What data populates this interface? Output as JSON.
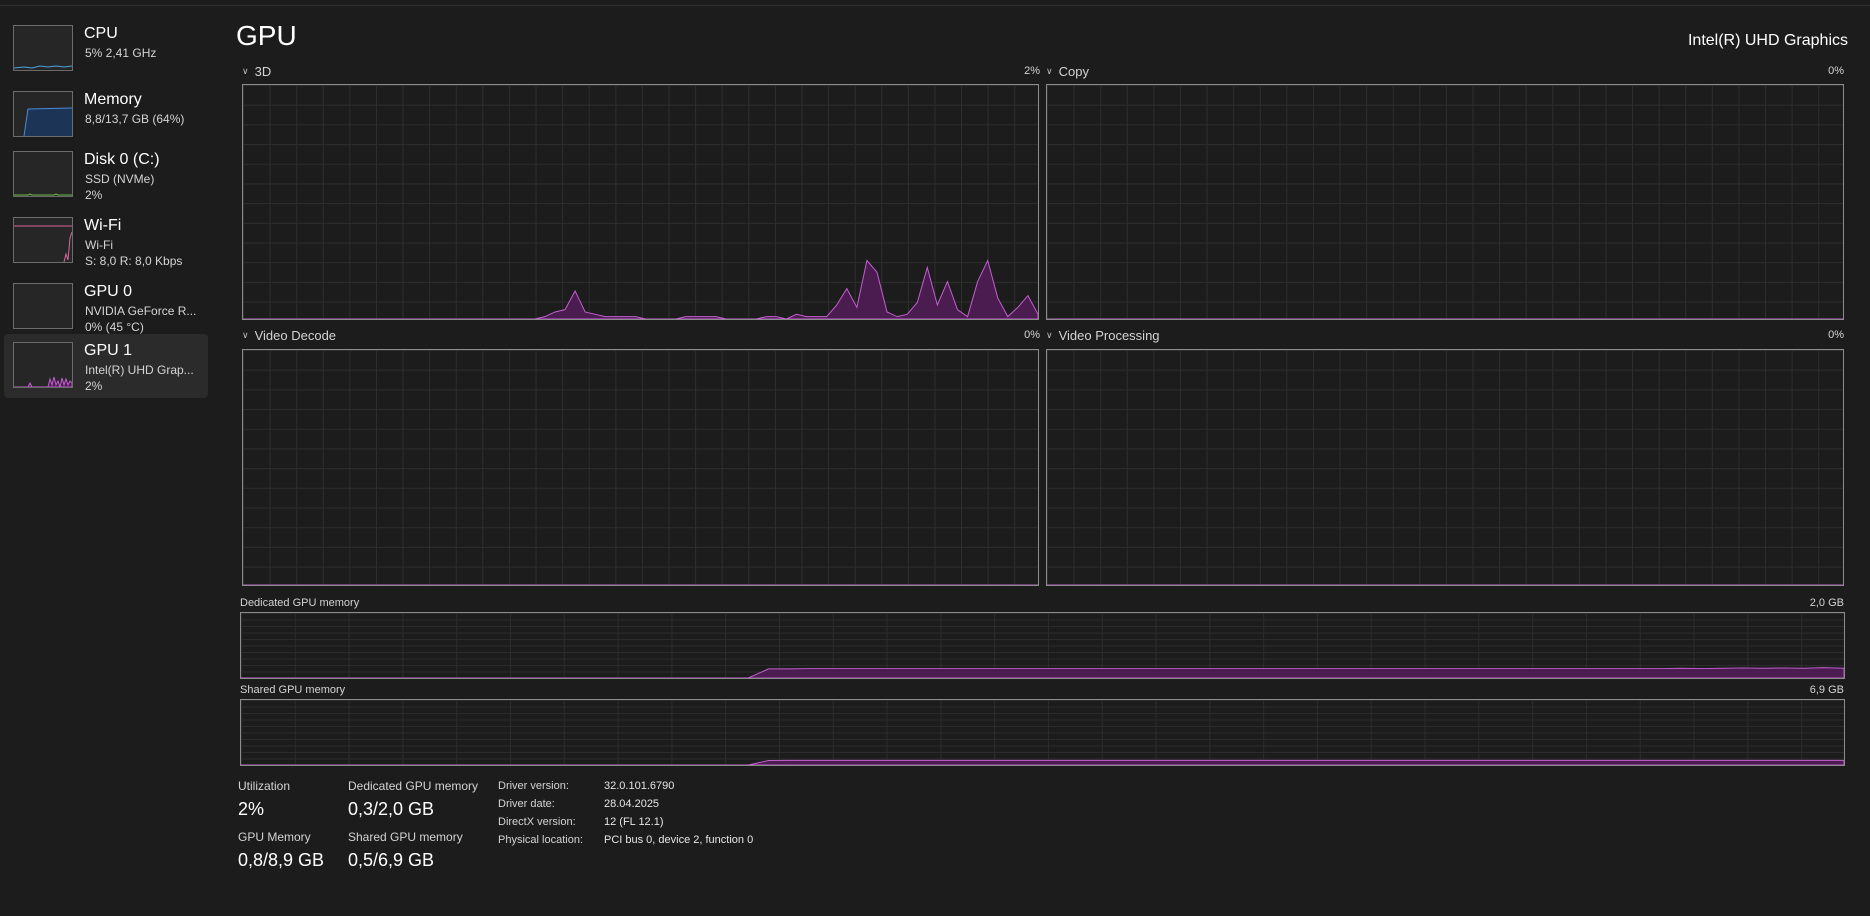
{
  "sidebar": {
    "items": [
      {
        "title": "CPU",
        "sub1": "5% 2,41 GHz",
        "sub2": ""
      },
      {
        "title": "Memory",
        "sub1": "8,8/13,7 GB (64%)",
        "sub2": ""
      },
      {
        "title": "Disk 0 (C:)",
        "sub1": "SSD (NVMe)",
        "sub2": "2%"
      },
      {
        "title": "Wi-Fi",
        "sub1": "Wi-Fi",
        "sub2": "S: 8,0 R: 8,0 Kbps"
      },
      {
        "title": "GPU 0",
        "sub1": "NVIDIA GeForce R...",
        "sub2": "0% (45 °C)"
      },
      {
        "title": "GPU 1",
        "sub1": "Intel(R) UHD Grap...",
        "sub2": "2%"
      }
    ]
  },
  "header": {
    "title": "GPU",
    "adapter_name": "Intel(R) UHD Graphics"
  },
  "engines": [
    {
      "label": "3D",
      "value": "2%"
    },
    {
      "label": "Copy",
      "value": "0%"
    },
    {
      "label": "Video Decode",
      "value": "0%"
    },
    {
      "label": "Video Processing",
      "value": "0%"
    }
  ],
  "memory_graphs": {
    "dedicated": {
      "label": "Dedicated GPU memory",
      "max": "2,0 GB"
    },
    "shared": {
      "label": "Shared GPU memory",
      "max": "6,9 GB"
    }
  },
  "stats": {
    "utilization": {
      "label": "Utilization",
      "value": "2%"
    },
    "dedicated": {
      "label": "Dedicated GPU memory",
      "value": "0,3/2,0 GB"
    },
    "gpu_memory": {
      "label": "GPU Memory",
      "value": "0,8/8,9 GB"
    },
    "shared": {
      "label": "Shared GPU memory",
      "value": "0,5/6,9 GB"
    }
  },
  "info": [
    {
      "key": "Driver version:",
      "value": "32.0.101.6790"
    },
    {
      "key": "Driver date:",
      "value": "28.04.2025"
    },
    {
      "key": "DirectX version:",
      "value": "12 (FL 12.1)"
    },
    {
      "key": "Physical location:",
      "value": "PCI bus 0, device 2, function 0"
    }
  ],
  "colors": {
    "gpu_line": "#c35fd0",
    "gpu_fill": "#4a1c4f",
    "memory_line": "#4a8ad8",
    "wifi_line": "#d9679a",
    "cpu_line": "#4aa3df"
  },
  "chart_data": {
    "type": "area",
    "series": [
      {
        "values": [
          0,
          0,
          0,
          0,
          0,
          0,
          0,
          0,
          0,
          0,
          0,
          0,
          0,
          0,
          0,
          0,
          0,
          0,
          0,
          0,
          0,
          0,
          0,
          0,
          0,
          0,
          0,
          0,
          0,
          0,
          1,
          3,
          4,
          12,
          3,
          2,
          1,
          1,
          1,
          1,
          0,
          0,
          0,
          0,
          1,
          1,
          1,
          1,
          0,
          0,
          0,
          0,
          1,
          1,
          0,
          2,
          1,
          1,
          1,
          6,
          13,
          5,
          25,
          20,
          3,
          1,
          2,
          7,
          22,
          6,
          16,
          4,
          1,
          16,
          25,
          9,
          1,
          5,
          10,
          2
        ]
      },
      {
        "values": [
          0,
          0,
          0,
          0,
          0,
          0,
          0,
          0,
          0,
          0,
          0,
          0,
          0,
          0,
          0,
          0,
          0,
          0,
          0,
          0,
          0,
          0,
          0,
          0,
          0,
          0,
          0,
          0,
          0,
          0,
          0,
          0,
          0,
          0,
          0,
          0,
          0,
          0,
          0,
          0,
          0,
          0,
          0,
          0,
          0,
          0,
          0,
          0,
          0,
          0,
          0,
          0,
          0,
          0,
          0,
          0,
          0,
          0,
          0,
          0,
          0,
          0,
          0,
          0,
          0,
          0,
          0,
          0,
          0,
          0,
          0,
          0,
          0,
          0,
          0,
          0,
          0,
          0,
          0,
          0
        ]
      },
      {
        "values": [
          0,
          0,
          0,
          0,
          0,
          0,
          0,
          0,
          0,
          0,
          0,
          0,
          0,
          0,
          0,
          0,
          0,
          0,
          0,
          0,
          0,
          0,
          0,
          0,
          0,
          0,
          0,
          0,
          0,
          0,
          0,
          0,
          0,
          0,
          0,
          0,
          0,
          0,
          0,
          0,
          0,
          0,
          0,
          0,
          0,
          0,
          0,
          0,
          0,
          0,
          0,
          0,
          0,
          0,
          0,
          0,
          0,
          0,
          0,
          0,
          0,
          0,
          0,
          0,
          0,
          0,
          0,
          0,
          0,
          0,
          0,
          0,
          0,
          0,
          0,
          0,
          0,
          0,
          0,
          0
        ]
      },
      {
        "values": [
          0,
          0,
          0,
          0,
          0,
          0,
          0,
          0,
          0,
          0,
          0,
          0,
          0,
          0,
          0,
          0,
          0,
          0,
          0,
          0,
          0,
          0,
          0,
          0,
          0,
          0,
          0,
          0,
          0,
          0,
          0,
          0,
          0,
          0,
          0,
          0,
          0,
          0,
          0,
          0,
          0,
          0,
          0,
          0,
          0,
          0,
          0,
          0,
          0,
          0,
          0,
          0,
          0,
          0,
          0,
          0,
          0,
          0,
          0,
          0,
          0,
          0,
          0,
          0,
          0,
          0,
          0,
          0,
          0,
          0,
          0,
          0,
          0,
          0,
          0,
          0,
          0,
          0,
          0,
          0
        ]
      },
      {
        "values": [
          0,
          0,
          0,
          0,
          0,
          0,
          0,
          0,
          0,
          0,
          0,
          0,
          0,
          0,
          0,
          0,
          0,
          0,
          0,
          0,
          0,
          0,
          0,
          0,
          0,
          0,
          0,
          0,
          0,
          0,
          0,
          0,
          0,
          0,
          0,
          0,
          0,
          0,
          0,
          0,
          0,
          0,
          0,
          0,
          0,
          0,
          0,
          0,
          0,
          0,
          0,
          0,
          0,
          0,
          0,
          0,
          0,
          0,
          0,
          0,
          0,
          0,
          0,
          0,
          0,
          0,
          0,
          0,
          0,
          0,
          0,
          0,
          0,
          0,
          0,
          0,
          0,
          0,
          0,
          0
        ]
      }
    ],
    "ylim": [
      0,
      100
    ],
    "memory_series": {
      "dedicated_gb": [
        0,
        0,
        0,
        0,
        0,
        0,
        0,
        0,
        0,
        0,
        0,
        0,
        0,
        0,
        0,
        0,
        0,
        0,
        0,
        0,
        0,
        0,
        0,
        0,
        0,
        0,
        0.28,
        0.28,
        0.29,
        0.29,
        0.29,
        0.29,
        0.29,
        0.29,
        0.29,
        0.29,
        0.29,
        0.29,
        0.29,
        0.29,
        0.29,
        0.29,
        0.29,
        0.29,
        0.29,
        0.29,
        0.29,
        0.29,
        0.29,
        0.29,
        0.29,
        0.29,
        0.29,
        0.29,
        0.29,
        0.29,
        0.29,
        0.29,
        0.29,
        0.29,
        0.29,
        0.29,
        0.29,
        0.29,
        0.29,
        0.29,
        0.29,
        0.29,
        0.29,
        0.29,
        0.29,
        0.3,
        0.29,
        0.3,
        0.31,
        0.3,
        0.31,
        0.3,
        0.32,
        0.3
      ],
      "dedicated_max_gb": 2.0,
      "shared_gb": [
        0,
        0,
        0,
        0,
        0,
        0,
        0,
        0,
        0,
        0,
        0,
        0,
        0,
        0,
        0,
        0,
        0,
        0,
        0,
        0,
        0,
        0,
        0,
        0,
        0,
        0,
        0.48,
        0.49,
        0.49,
        0.49,
        0.49,
        0.49,
        0.49,
        0.49,
        0.49,
        0.49,
        0.49,
        0.49,
        0.49,
        0.49,
        0.49,
        0.49,
        0.49,
        0.49,
        0.49,
        0.49,
        0.49,
        0.49,
        0.49,
        0.49,
        0.49,
        0.49,
        0.49,
        0.49,
        0.49,
        0.49,
        0.49,
        0.49,
        0.49,
        0.49,
        0.49,
        0.49,
        0.49,
        0.49,
        0.49,
        0.49,
        0.49,
        0.49,
        0.49,
        0.49,
        0.49,
        0.49,
        0.49,
        0.49,
        0.49,
        0.49,
        0.49,
        0.49,
        0.49,
        0.49
      ],
      "shared_max_gb": 6.9
    }
  }
}
